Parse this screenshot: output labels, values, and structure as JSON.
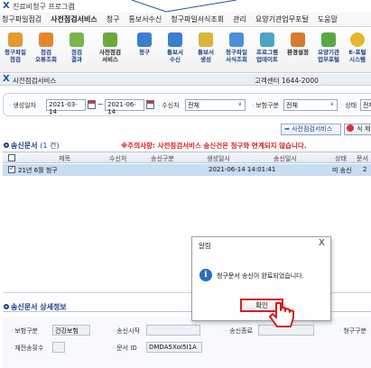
{
  "window": {
    "title": "진료비청구 프로그램"
  },
  "menu": {
    "items": [
      "청구파일점검",
      "사전점검서비스",
      "청구",
      "통보서수신",
      "청구파일서식조회",
      "관리",
      "요양기관업무포털",
      "도움말"
    ]
  },
  "toolbar": {
    "buttons": [
      {
        "label": "청구파일\n점검",
        "icon": "file-check-icon"
      },
      {
        "label": "점검\n오류조회",
        "icon": "error-search-icon"
      },
      {
        "label": "점검\n결과",
        "icon": "check-result-icon"
      },
      {
        "label": "사전점검\n서비스",
        "icon": "pre-check-service-icon"
      },
      {
        "label": "청구",
        "icon": "claim-icon"
      },
      {
        "label": "통보서\n수신",
        "icon": "notice-receive-icon"
      },
      {
        "label": "통보서\n생성",
        "icon": "notice-create-icon"
      },
      {
        "label": "청구파일\n서식조회",
        "icon": "form-search-icon"
      },
      {
        "label": "프로그램\n업데이트",
        "icon": "update-icon"
      },
      {
        "label": "환경설정",
        "icon": "settings-icon"
      },
      {
        "label": "요양기관\n업무포털",
        "icon": "portal-icon"
      },
      {
        "label": "E-포털\n시스템",
        "icon": "e-portal-icon"
      }
    ]
  },
  "subwindow": {
    "title": "사전점검서비스",
    "call_center": "고객센터 1644-2000"
  },
  "search": {
    "create_date_label": "생성일자",
    "date_from": "2021-03-14",
    "date_sep": "~",
    "date_to": "2021-06-14",
    "receiver_label": "수신처",
    "receiver_value": "전체",
    "insurance_label": "보험구분",
    "insurance_value": "전체",
    "status_label": "상태",
    "status_value": "전체"
  },
  "actions": {
    "send": "사전점검서비스",
    "delete": "삭 제"
  },
  "send_docs": {
    "title": "송신문서",
    "count": "(1 건)",
    "notice": "※주의사항: 사전점검서비스 송신건은 청구와 연계되지 않습니다.",
    "columns": [
      "제목",
      "수신처",
      "송신구분",
      "생성일시",
      "송신일시",
      "상태",
      "문서"
    ],
    "rows": [
      {
        "title": "21년 6월 청구",
        "created": "2021-06-14 14:01:41",
        "status": "미 송신",
        "doc": "2",
        "checked": true
      }
    ]
  },
  "detail": {
    "title": "송신문서 상세정보",
    "insurance_label": "보험구분",
    "insurance_value": "건강보험",
    "send_start_label": "송신시작",
    "send_end_label": "송신종료",
    "claim_label": "청구구분",
    "resend_label": "재전송횟수",
    "doc_id_label": "문서 ID",
    "doc_id_value": "DMDA5XoI5I1A"
  },
  "dialog": {
    "title": "알림",
    "close": "X",
    "message": "청구문서 송신이 완료되었습니다.",
    "ok": "확인"
  }
}
